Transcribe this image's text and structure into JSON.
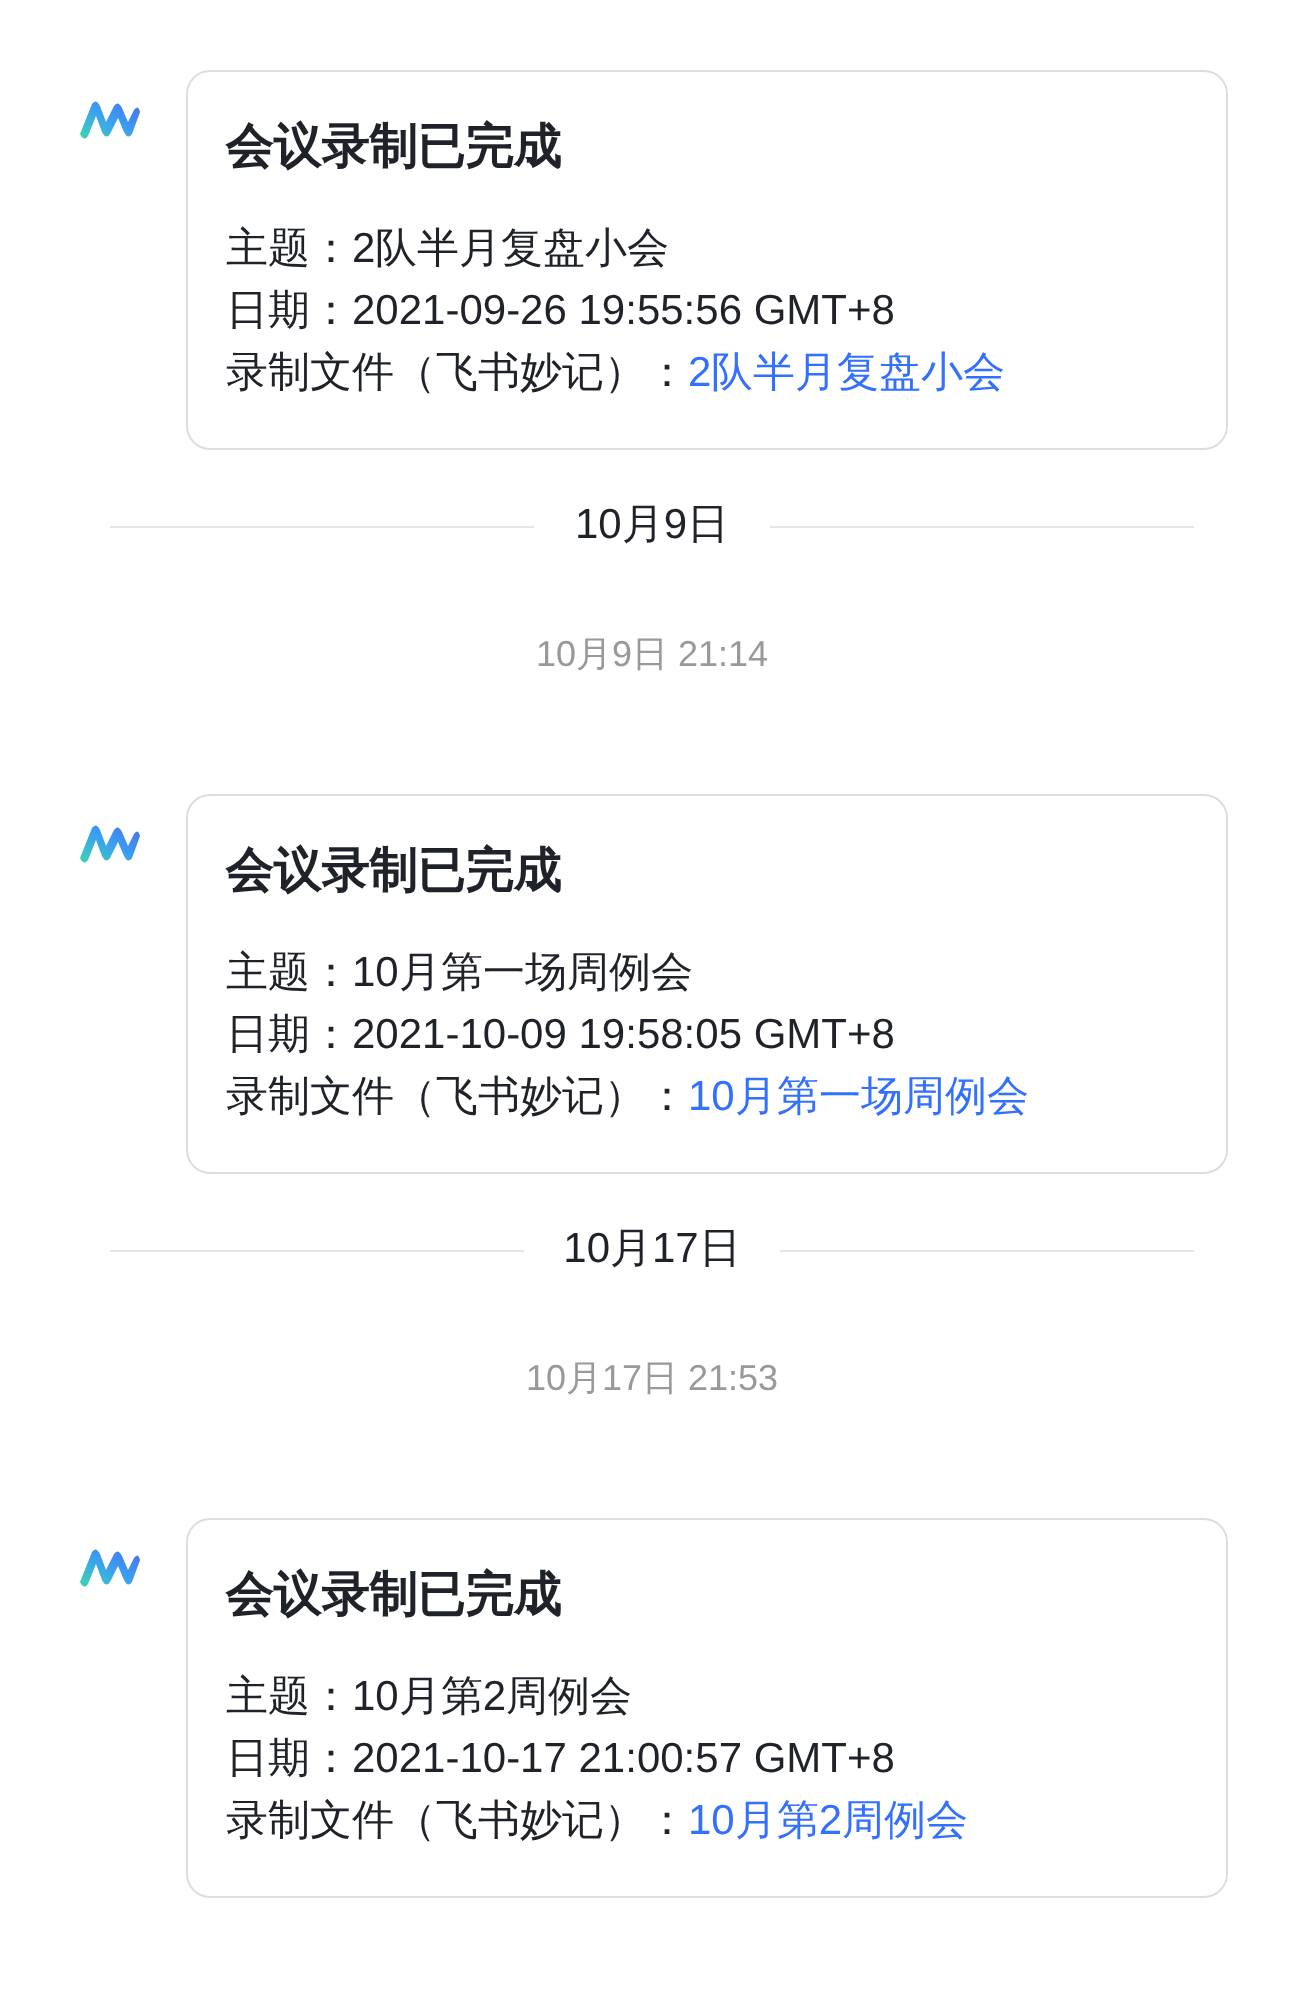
{
  "feed": [
    {
      "kind": "message",
      "title": "会议录制已完成",
      "lines": [
        {
          "kind": "text",
          "label": "主题：",
          "value": "2队半月复盘小会"
        },
        {
          "kind": "text",
          "label": "日期：",
          "value": "2021-09-26 19:55:56 GMT+8"
        },
        {
          "kind": "link",
          "label": "录制文件（飞书妙记）：",
          "value": "2队半月复盘小会"
        }
      ]
    },
    {
      "kind": "date_divider",
      "text": "10月9日"
    },
    {
      "kind": "timestamp",
      "text": "10月9日 21:14"
    },
    {
      "kind": "message",
      "title": "会议录制已完成",
      "lines": [
        {
          "kind": "text",
          "label": "主题：",
          "value": "10月第一场周例会"
        },
        {
          "kind": "text",
          "label": "日期：",
          "value": "2021-10-09 19:58:05 GMT+8"
        },
        {
          "kind": "link",
          "label": "录制文件（飞书妙记）：",
          "value": "10月第一场周例会"
        }
      ]
    },
    {
      "kind": "date_divider",
      "text": "10月17日"
    },
    {
      "kind": "timestamp",
      "text": "10月17日 21:53"
    },
    {
      "kind": "message",
      "title": "会议录制已完成",
      "lines": [
        {
          "kind": "text",
          "label": "主题：",
          "value": "10月第2周例会"
        },
        {
          "kind": "text",
          "label": "日期：",
          "value": "2021-10-17 21:00:57 GMT+8"
        },
        {
          "kind": "link",
          "label": "录制文件（飞书妙记）：",
          "value": "10月第2周例会"
        }
      ]
    }
  ]
}
